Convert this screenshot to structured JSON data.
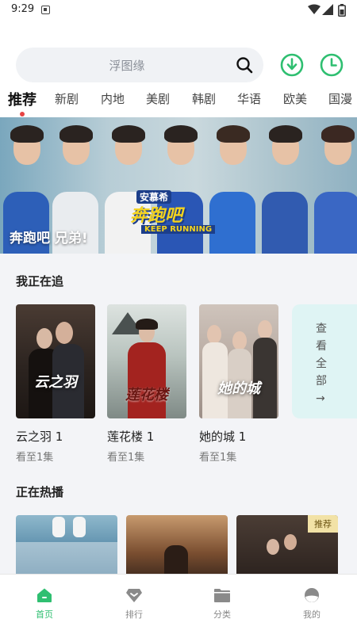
{
  "status": {
    "time": "9:29"
  },
  "search": {
    "placeholder": "浮图缘"
  },
  "colors": {
    "accent": "#2fbf71",
    "badge_bg": "#f2e2a6"
  },
  "category_tabs": [
    {
      "label": "推荐",
      "active": true
    },
    {
      "label": "新剧"
    },
    {
      "label": "内地"
    },
    {
      "label": "美剧"
    },
    {
      "label": "韩剧"
    },
    {
      "label": "华语"
    },
    {
      "label": "欧美"
    },
    {
      "label": "国漫"
    }
  ],
  "banner": {
    "caption": "奔跑吧 兄弟!",
    "logo_sub": "安慕希",
    "logo_main": "奔跑吧",
    "logo_en": "KEEP RUNNING"
  },
  "watching": {
    "title": "我正在追",
    "items": [
      {
        "name": "云之羽 1",
        "progress": "看至1集",
        "poster_text": "云之羽"
      },
      {
        "name": "莲花楼 1",
        "progress": "看至1集",
        "poster_text": "莲花楼"
      },
      {
        "name": "她的城 1",
        "progress": "看至1集",
        "poster_text": "她的城"
      }
    ],
    "view_all": "查看全部→"
  },
  "hot": {
    "title": "正在热播",
    "badge": "推荐"
  },
  "bottom_nav": [
    {
      "label": "首页",
      "icon": "home-icon",
      "active": true
    },
    {
      "label": "排行",
      "icon": "ranking-icon"
    },
    {
      "label": "分类",
      "icon": "folder-icon"
    },
    {
      "label": "我的",
      "icon": "profile-icon"
    }
  ]
}
